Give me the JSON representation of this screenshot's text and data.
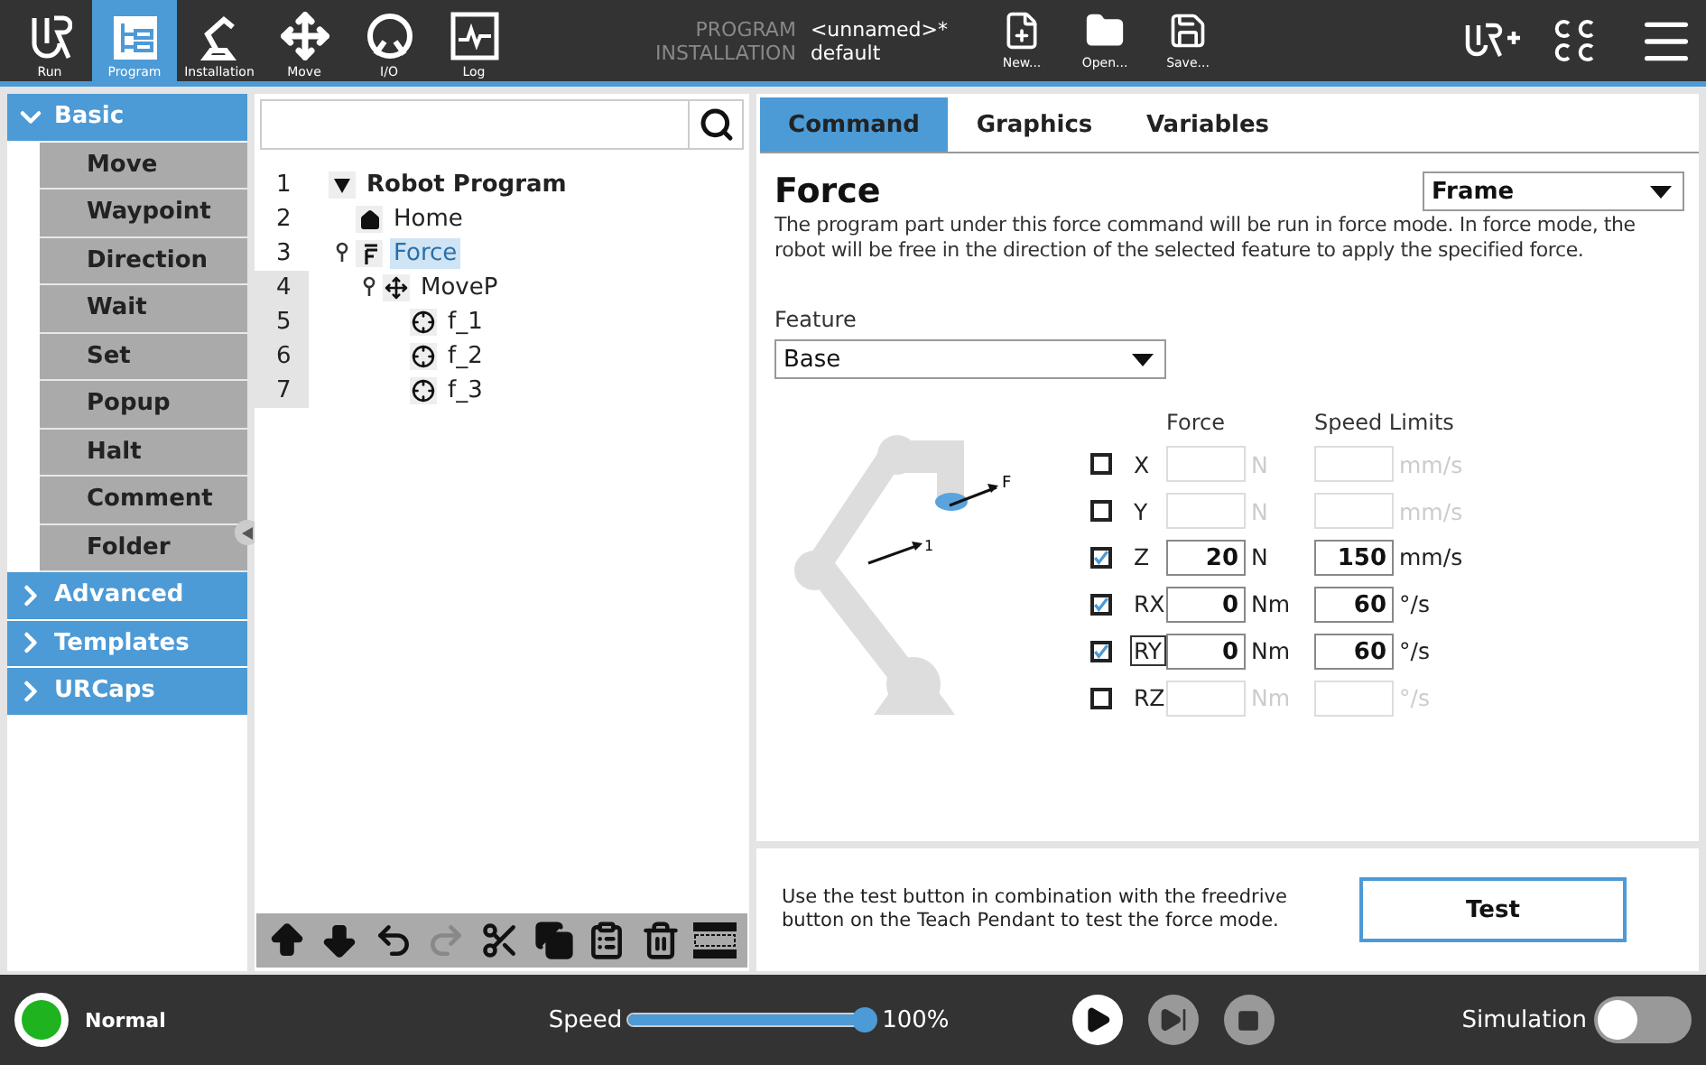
{
  "top_bar": {
    "nav": [
      {
        "label": "Run",
        "kind": "run",
        "selected": false
      },
      {
        "label": "Program",
        "kind": "program",
        "selected": true
      },
      {
        "label": "Installation",
        "kind": "installation",
        "selected": false
      },
      {
        "label": "Move",
        "kind": "move",
        "selected": false
      },
      {
        "label": "I/O",
        "kind": "io",
        "selected": false
      },
      {
        "label": "Log",
        "kind": "log",
        "selected": false
      }
    ],
    "program_label": "PROGRAM",
    "program_name": "<unnamed>*",
    "installation_label": "INSTALLATION",
    "installation_name": "default",
    "file_buttons": [
      {
        "label": "New...",
        "kind": "new"
      },
      {
        "label": "Open...",
        "kind": "open"
      },
      {
        "label": "Save...",
        "kind": "save"
      }
    ]
  },
  "sidebar": {
    "categories": [
      {
        "label": "Basic",
        "expanded": true,
        "items": [
          "Move",
          "Waypoint",
          "Direction",
          "Wait",
          "Set",
          "Popup",
          "Halt",
          "Comment",
          "Folder"
        ]
      },
      {
        "label": "Advanced",
        "expanded": false
      },
      {
        "label": "Templates",
        "expanded": false
      },
      {
        "label": "URCaps",
        "expanded": false
      }
    ]
  },
  "tree": {
    "nodes": [
      {
        "number": "1",
        "label": "Robot Program",
        "kind": "root",
        "selected": false,
        "expanded": true,
        "children": [
          {
            "number": "2",
            "label": "Home",
            "kind": "home",
            "selected": false
          },
          {
            "number": "3",
            "label": "Force",
            "kind": "force",
            "selected": true,
            "children": [
              {
                "number": "4",
                "label": "MoveP",
                "kind": "move",
                "selected": false,
                "children": [
                  {
                    "number": "5",
                    "label": "f_1",
                    "kind": "waypoint",
                    "selected": false
                  },
                  {
                    "number": "6",
                    "label": "f_2",
                    "kind": "waypoint",
                    "selected": false
                  },
                  {
                    "number": "7",
                    "label": "f_3",
                    "kind": "waypoint",
                    "selected": false
                  }
                ]
              }
            ]
          }
        ]
      }
    ],
    "tools": [
      {
        "kind": "up",
        "disabled": false
      },
      {
        "kind": "down",
        "disabled": false
      },
      {
        "kind": "undo",
        "disabled": false
      },
      {
        "kind": "redo",
        "disabled": true
      },
      {
        "kind": "cut",
        "disabled": false
      },
      {
        "kind": "copy",
        "disabled": false
      },
      {
        "kind": "paste",
        "disabled": false
      },
      {
        "kind": "delete",
        "disabled": false
      },
      {
        "kind": "suppress",
        "disabled": false
      }
    ]
  },
  "tabs": [
    {
      "label": "Command",
      "selected": true
    },
    {
      "label": "Graphics",
      "selected": false
    },
    {
      "label": "Variables",
      "selected": false
    }
  ],
  "command": {
    "title": "Force",
    "frame_select": "Frame",
    "description": "The program part under this force command will be run in force mode. In force mode, the robot will be free in the direction of the selected feature to apply the specified force.",
    "feature_label": "Feature",
    "feature_value": "Base",
    "robot_labels": [
      "F",
      "1"
    ],
    "force_header": "Force",
    "speed_header": "Speed Limits",
    "axes": [
      {
        "label": "X",
        "checked": false,
        "focused": false,
        "force_unit": "N",
        "speed_unit": "mm/s"
      },
      {
        "label": "Y",
        "checked": false,
        "focused": false,
        "force_unit": "N",
        "speed_unit": "mm/s"
      },
      {
        "label": "Z",
        "checked": true,
        "focused": false,
        "force": "20",
        "force_unit": "N",
        "speed": "150",
        "speed_unit": "mm/s"
      },
      {
        "label": "RX",
        "checked": true,
        "focused": false,
        "force": "0",
        "force_unit": "Nm",
        "speed": "60",
        "speed_unit": "°/s"
      },
      {
        "label": "RY",
        "checked": true,
        "focused": true,
        "force": "0",
        "force_unit": "Nm",
        "speed": "60",
        "speed_unit": "°/s"
      },
      {
        "label": "RZ",
        "checked": false,
        "focused": false,
        "force_unit": "Nm",
        "speed_unit": "°/s"
      }
    ],
    "test_hint": "Use the test button in combination with the freedrive button on the Teach Pendant to test the force mode.",
    "test_button": "Test"
  },
  "status_bar": {
    "state": "Normal",
    "speed_label": "Speed",
    "speed": {
      "level": 1.0
    },
    "speed_reading": "100%",
    "simulation_label": "Simulation",
    "simulation": {
      "on": false
    }
  }
}
